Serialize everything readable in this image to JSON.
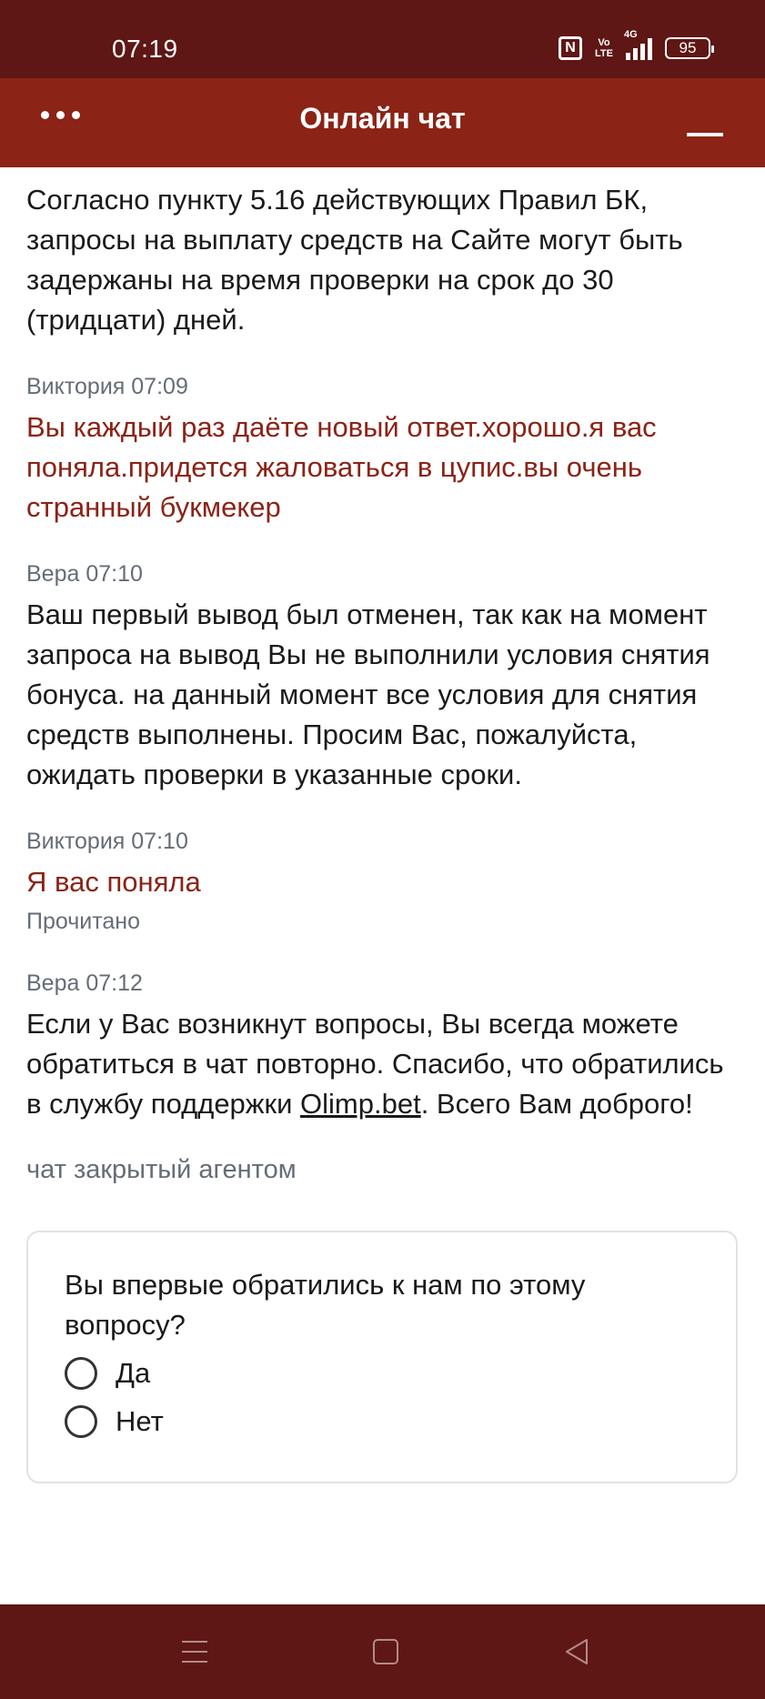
{
  "status_bar": {
    "time": "07:19",
    "nfc": "N",
    "volte_top": "Vo",
    "volte_bottom": "LTE",
    "network": "4G",
    "battery": "95"
  },
  "header": {
    "title": "Онлайн чат"
  },
  "messages": [
    {
      "text": "Согласно пункту 5.16 действующих Правил БК, запросы на выплату средств на Сайте могут быть задержаны на время проверки на срок до 30 (тридцати) дней."
    },
    {
      "meta": "Виктория 07:09",
      "text": "Вы каждый раз даёте новый ответ.хорошо.я вас поняла.придется жаловаться в цупис.вы очень странный букмекер"
    },
    {
      "meta": "Вера 07:10",
      "text": "Ваш первый вывод был отменен, так как на момент запроса на вывод Вы не выполнили условия снятия бонуса. на данный момент все условия для снятия средств выполнены. Просим Вас, пожалуйста, ожидать проверки в указанные сроки."
    },
    {
      "meta": "Виктория 07:10",
      "text": "Я вас поняла",
      "status": "Прочитано"
    },
    {
      "meta": "Вера 07:12",
      "text_before": "Если у Вас возникнут вопросы, Вы всегда можете обратиться в чат повторно. Спасибо, что обратились в службу поддержки ",
      "link": "Olimp.bet",
      "text_after": ". Всего Вам доброго!"
    }
  ],
  "system_note": "чат закрытый агентом",
  "survey": {
    "question": "Вы впервые обратились к нам по этому вопросу?",
    "options": [
      "Да",
      "Нет"
    ]
  },
  "colors": {
    "status_bar": "#5e1715",
    "header": "#8b2316",
    "user_text": "#8b2316"
  }
}
